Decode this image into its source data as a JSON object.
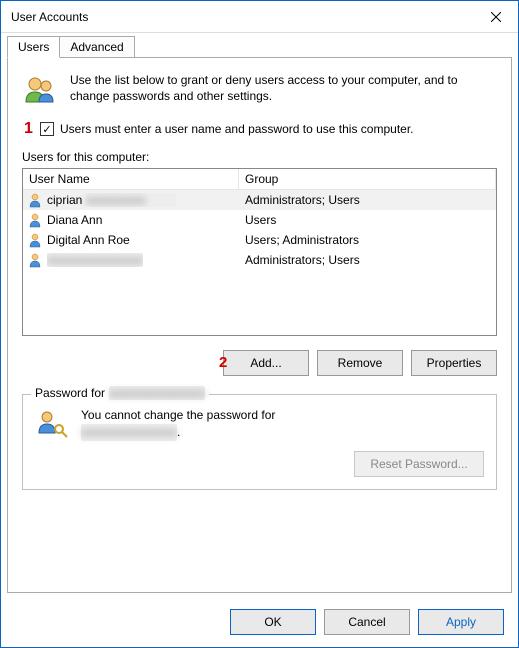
{
  "window": {
    "title": "User Accounts"
  },
  "tabs": {
    "users": "Users",
    "advanced": "Advanced"
  },
  "intro": "Use the list below to grant or deny users access to your computer, and to change passwords and other settings.",
  "checkbox": {
    "label": "Users must enter a user name and password to use this computer.",
    "checked": "✓"
  },
  "users_label": "Users for this computer:",
  "columns": {
    "name": "User Name",
    "group": "Group"
  },
  "users": [
    {
      "name": "ciprian",
      "name_redacted": "xxxxxxxxxx",
      "group": "Administrators; Users",
      "selected": true
    },
    {
      "name": "Diana Ann",
      "name_redacted": "",
      "group": "Users",
      "selected": false
    },
    {
      "name": "Digital Ann Roe",
      "name_redacted": "",
      "group": "Users; Administrators",
      "selected": false
    },
    {
      "name": "",
      "name_redacted": "xxxxxxxxxxxxxxxx",
      "group": "Administrators; Users",
      "selected": false
    }
  ],
  "buttons": {
    "add": "Add...",
    "remove": "Remove",
    "properties": "Properties",
    "reset_password": "Reset Password...",
    "ok": "OK",
    "cancel": "Cancel",
    "apply": "Apply"
  },
  "password_group": {
    "legend_prefix": "Password for",
    "legend_redacted": "xxxxxxxxxxxxxxxx",
    "msg_prefix": "You cannot change the password for",
    "msg_redacted": "xxxxxxxxxxxxxxxx",
    "msg_suffix": "."
  },
  "annotations": {
    "one": "1",
    "two": "2"
  }
}
